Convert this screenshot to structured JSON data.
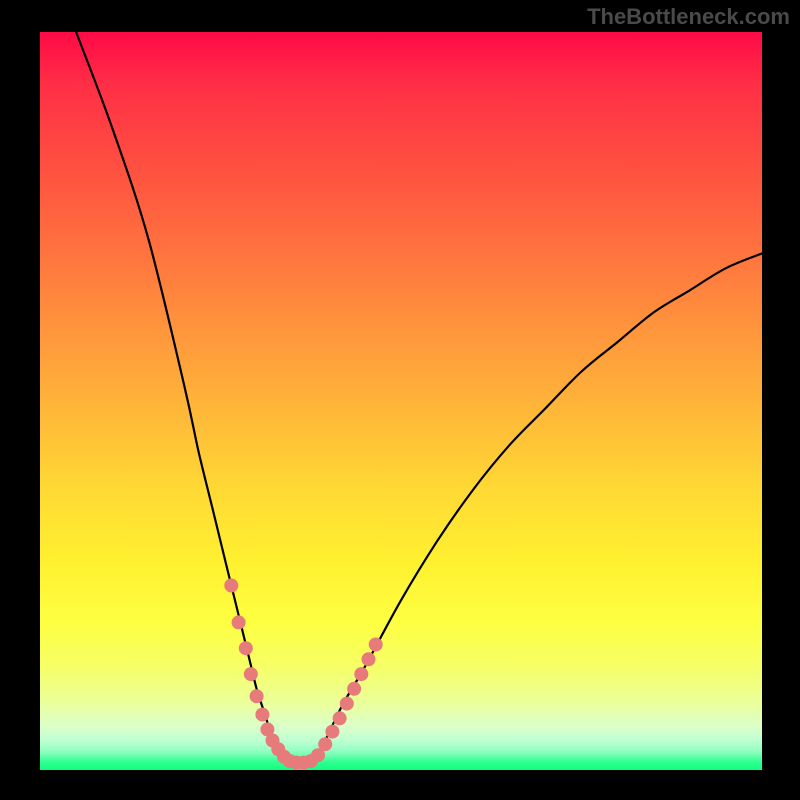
{
  "watermark": "TheBottleneck.com",
  "colors": {
    "frame_bg": "#000000",
    "curve_stroke": "#000000",
    "marker_fill": "#e77a7a",
    "gradient_top": "#ff0a46",
    "gradient_mid": "#fff130",
    "gradient_bottom": "#12ff7e"
  },
  "chart_data": {
    "type": "line",
    "title": "",
    "xlabel": "",
    "ylabel": "",
    "xlim": [
      0,
      100
    ],
    "ylim": [
      0,
      100
    ],
    "grid": false,
    "legend": false,
    "series": [
      {
        "name": "bottleneck-curve",
        "x": [
          5,
          10,
          15,
          20,
          22,
          24,
          26,
          28,
          29,
          30,
          31,
          32,
          33,
          34,
          35,
          36,
          37,
          38,
          39,
          40,
          42,
          45,
          50,
          55,
          60,
          65,
          70,
          75,
          80,
          85,
          90,
          95,
          100
        ],
        "y": [
          100,
          87,
          72,
          52,
          43,
          35,
          27,
          19,
          15,
          11,
          8,
          5,
          3,
          2,
          1,
          1,
          1,
          2,
          3,
          5,
          9,
          14,
          23,
          31,
          38,
          44,
          49,
          54,
          58,
          62,
          65,
          68,
          70
        ]
      }
    ],
    "markers": {
      "name": "highlight-points",
      "x": [
        26.5,
        27.5,
        28.5,
        29.2,
        30.0,
        30.8,
        31.5,
        32.2,
        33.0,
        33.8,
        34.6,
        35.5,
        36.5,
        37.5,
        38.5,
        39.5,
        40.5,
        41.5,
        42.5,
        43.5,
        44.5,
        45.5,
        46.5
      ],
      "y": [
        25.0,
        20.0,
        16.5,
        13.0,
        10.0,
        7.5,
        5.5,
        4.0,
        2.8,
        1.8,
        1.2,
        1.0,
        1.0,
        1.2,
        2.0,
        3.5,
        5.2,
        7.0,
        9.0,
        11.0,
        13.0,
        15.0,
        17.0
      ]
    },
    "annotations": []
  }
}
